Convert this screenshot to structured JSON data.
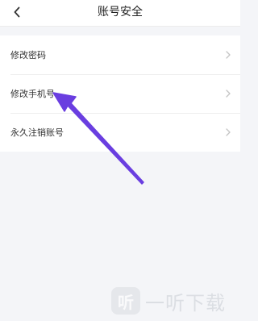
{
  "header": {
    "title": "账号安全",
    "back_icon": "chevron-left-icon"
  },
  "menu": {
    "items": [
      {
        "label": "修改密码",
        "icon": "chevron-right-icon"
      },
      {
        "label": "修改手机号",
        "icon": "chevron-right-icon"
      },
      {
        "label": "永久注销账号",
        "icon": "chevron-right-icon"
      }
    ]
  },
  "annotation": {
    "arrow_color": "#6a3ee0",
    "points_to": "修改手机号"
  },
  "watermark": {
    "badge": "听",
    "text": "一听下载"
  },
  "colors": {
    "background": "#f4f5f8",
    "surface": "#ffffff",
    "chevron": "#c4c4c4"
  }
}
